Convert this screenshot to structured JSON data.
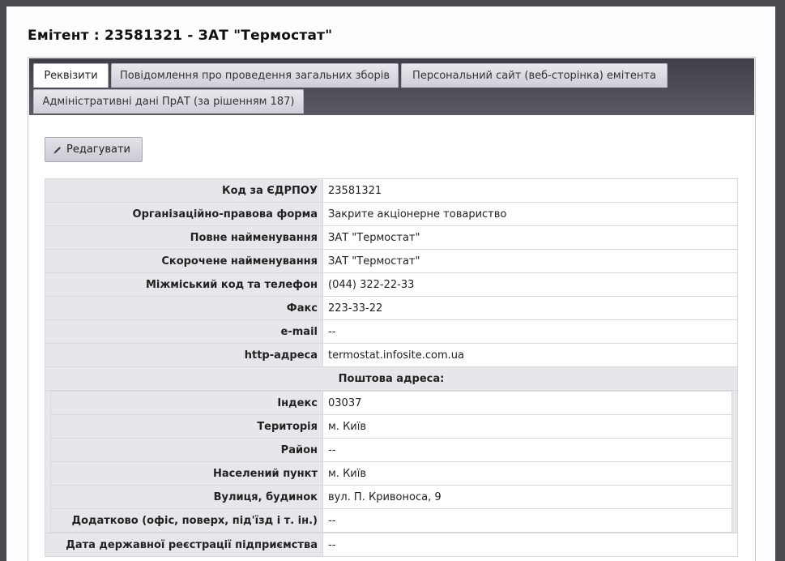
{
  "page": {
    "title": "Емітент : 23581321 - ЗАТ \"Термостат\""
  },
  "tabs": [
    {
      "label": "Реквізити",
      "active": true
    },
    {
      "label": "Повідомлення про проведення загальних зборів",
      "active": false
    },
    {
      "label": "Персональний сайт (веб-сторінка) емітента",
      "active": false
    },
    {
      "label": "Адміністративні дані ПрАТ (за рішенням 187)",
      "active": false
    }
  ],
  "toolbar": {
    "edit_label": "Редагувати",
    "edit_icon": "pencil-icon"
  },
  "requisites": [
    {
      "label": "Код за ЄДРПОУ",
      "value": "23581321"
    },
    {
      "label": "Організаційно-правова форма",
      "value": "Закрите акціонерне товариство"
    },
    {
      "label": "Повне найменування",
      "value": "ЗАТ \"Термостат\""
    },
    {
      "label": "Скорочене найменування",
      "value": "ЗАТ \"Термостат\""
    },
    {
      "label": "Міжміський код та телефон",
      "value": "(044) 322-22-33"
    },
    {
      "label": "Факс",
      "value": "223-33-22"
    },
    {
      "label": "e-mail",
      "value": "--"
    },
    {
      "label": "http-адреса",
      "value": "termostat.infosite.com.ua"
    }
  ],
  "postal": {
    "heading": "Поштова адреса:",
    "rows": [
      {
        "label": "Індекс",
        "value": "03037"
      },
      {
        "label": "Територія",
        "value": "м. Київ"
      },
      {
        "label": "Район",
        "value": "--"
      },
      {
        "label": "Населений пункт",
        "value": "м. Київ"
      },
      {
        "label": "Вулиця, будинок",
        "value": "вул. П. Кривоноса, 9"
      },
      {
        "label": "Додатково (офіс, поверх, під'їзд і т. ін.)",
        "value": "--"
      }
    ]
  },
  "registration": {
    "label": "Дата державної реєстрації підприємства",
    "value": "--"
  }
}
